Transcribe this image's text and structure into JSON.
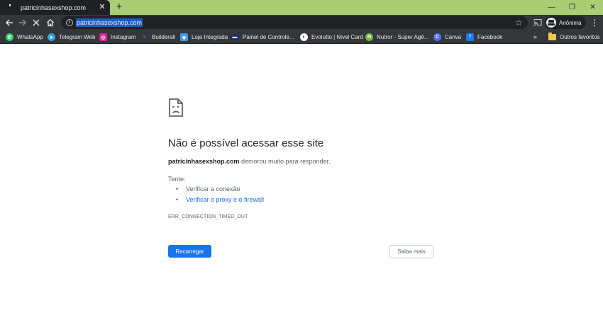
{
  "colors": {
    "title_bar": "#a9cf72",
    "toolbar": "#35363a",
    "tab": "#202124",
    "url_selection": "#1a5ccb",
    "primary_button": "#1a73e8",
    "link": "#1a73e8"
  },
  "tab": {
    "title": "patricinhasexshop.com",
    "close_glyph": "✕"
  },
  "titlebar": {
    "new_tab_glyph": "+",
    "minimize_glyph": "—",
    "restore_glyph": "❐",
    "close_glyph": "✕"
  },
  "toolbar": {
    "url": "patricinhasexshop.com",
    "info_glyph": "i",
    "star_glyph": "☆",
    "profile_label": "Anônima",
    "menu_glyph": "⋮"
  },
  "bookmarks": {
    "items": [
      {
        "label": "WhatsApp",
        "icon": "whatsapp-icon",
        "color": "#25d366",
        "glyph": "✆"
      },
      {
        "label": "Telegram Web",
        "icon": "telegram-icon",
        "color": "#2aa3d9",
        "glyph": "➤"
      },
      {
        "label": "Instagram",
        "icon": "instagram-icon",
        "color": "#d6249f",
        "glyph": "◎"
      },
      {
        "label": "Builderall",
        "icon": "builderall-icon",
        "color": "#1c6ef2",
        "glyph": "≈"
      },
      {
        "label": "Loja Integrada",
        "icon": "loja-integrada-icon",
        "color": "#3d9be9",
        "glyph": "◆"
      },
      {
        "label": "Painel de Controle...",
        "icon": "painel-icon",
        "color": "#1b2a6b",
        "glyph": "▬"
      },
      {
        "label": "Evolutto | Nivel Card",
        "icon": "evolutto-icon",
        "color": "#ffffff",
        "glyph": "◐"
      },
      {
        "label": "Nutror - Super Agê...",
        "icon": "nutror-icon",
        "color": "#6fbf3a",
        "glyph": "N"
      },
      {
        "label": "Canva",
        "icon": "canva-icon",
        "color": "#4b6ff0",
        "glyph": "C"
      },
      {
        "label": "Facebook",
        "icon": "facebook-icon",
        "color": "#1877f2",
        "glyph": "f"
      }
    ],
    "overflow_glyph": "»",
    "other_favorites": "Outros favoritos"
  },
  "error_page": {
    "title": "Não é possível acessar esse site",
    "domain": "patricinhasexshop.com",
    "description_rest": " demorou muito para responder.",
    "try_label": "Tente:",
    "suggestions": [
      "Verificar a conexão",
      "Verificar o proxy e o firewall"
    ],
    "error_code": "ERR_CONNECTION_TIMED_OUT",
    "reload_button": "Recarregar",
    "more_button": "Saiba mais"
  }
}
